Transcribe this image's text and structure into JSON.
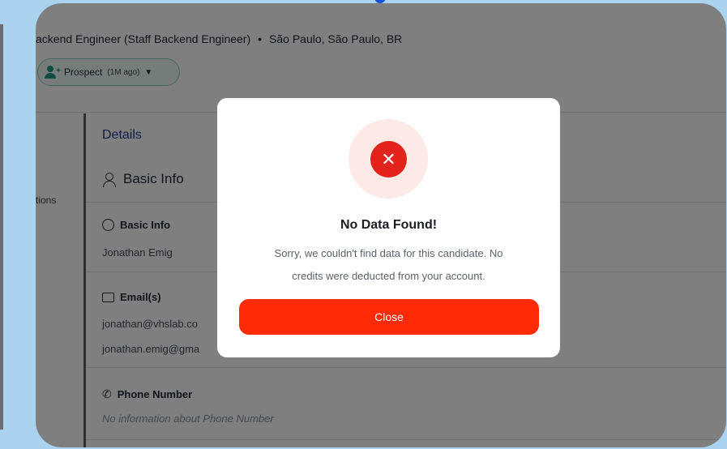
{
  "header": {
    "job_title": "ackend Engineer (Staff Backend Engineer)",
    "separator": "•",
    "location": "São Paulo, São Paulo, BR",
    "status": {
      "label": "Prospect",
      "time": "(1M ago)"
    }
  },
  "side_nav": {
    "partial_label": "tions"
  },
  "details": {
    "heading": "Details",
    "basic_info_section": "Basic Info",
    "basic_info_label": "Basic Info",
    "name": "Jonathan Emig",
    "emails_label": "Email(s)",
    "emails": [
      "jonathan@vhslab.co",
      "jonathan.emig@gma"
    ],
    "phone_label": "Phone Number",
    "phone_empty": "No information about Phone Number"
  },
  "modal": {
    "icon": "error-x-icon",
    "icon_glyph": "✕",
    "title": "No Data Found!",
    "message_line1": "Sorry, we couldn't find data for this candidate. No",
    "message_line2": "credits were deducted from your account.",
    "close_label": "Close"
  },
  "colors": {
    "accent": "#ff2a06",
    "error": "#e3231b",
    "status": "#1f9b85",
    "heading": "#1e3a8a"
  }
}
